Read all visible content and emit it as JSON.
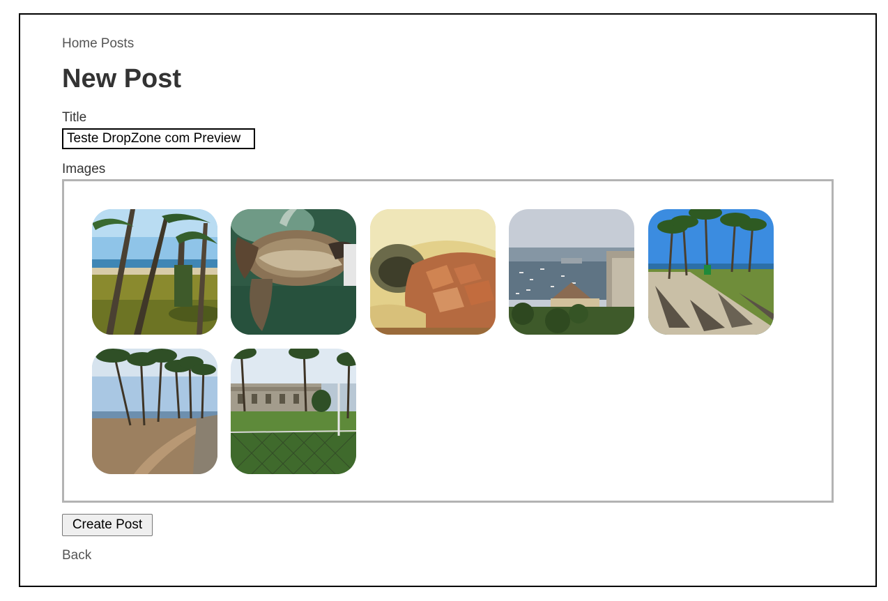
{
  "nav": {
    "links": [
      {
        "label": "Home"
      },
      {
        "label": "Posts"
      }
    ]
  },
  "page_title": "New Post",
  "form": {
    "title_label": "Title",
    "title_value": "Teste DropZone com Preview",
    "images_label": "Images",
    "images": [
      {
        "icon": "beach-palm-trees-image"
      },
      {
        "icon": "sea-turtle-underwater-image"
      },
      {
        "icon": "sea-turtle-shell-closeup-image"
      },
      {
        "icon": "harbor-bay-boats-image"
      },
      {
        "icon": "palm-boardwalk-image"
      },
      {
        "icon": "palm-beach-path-image"
      },
      {
        "icon": "building-lawn-fence-image"
      }
    ],
    "submit_label": "Create Post"
  },
  "back_link": "Back"
}
